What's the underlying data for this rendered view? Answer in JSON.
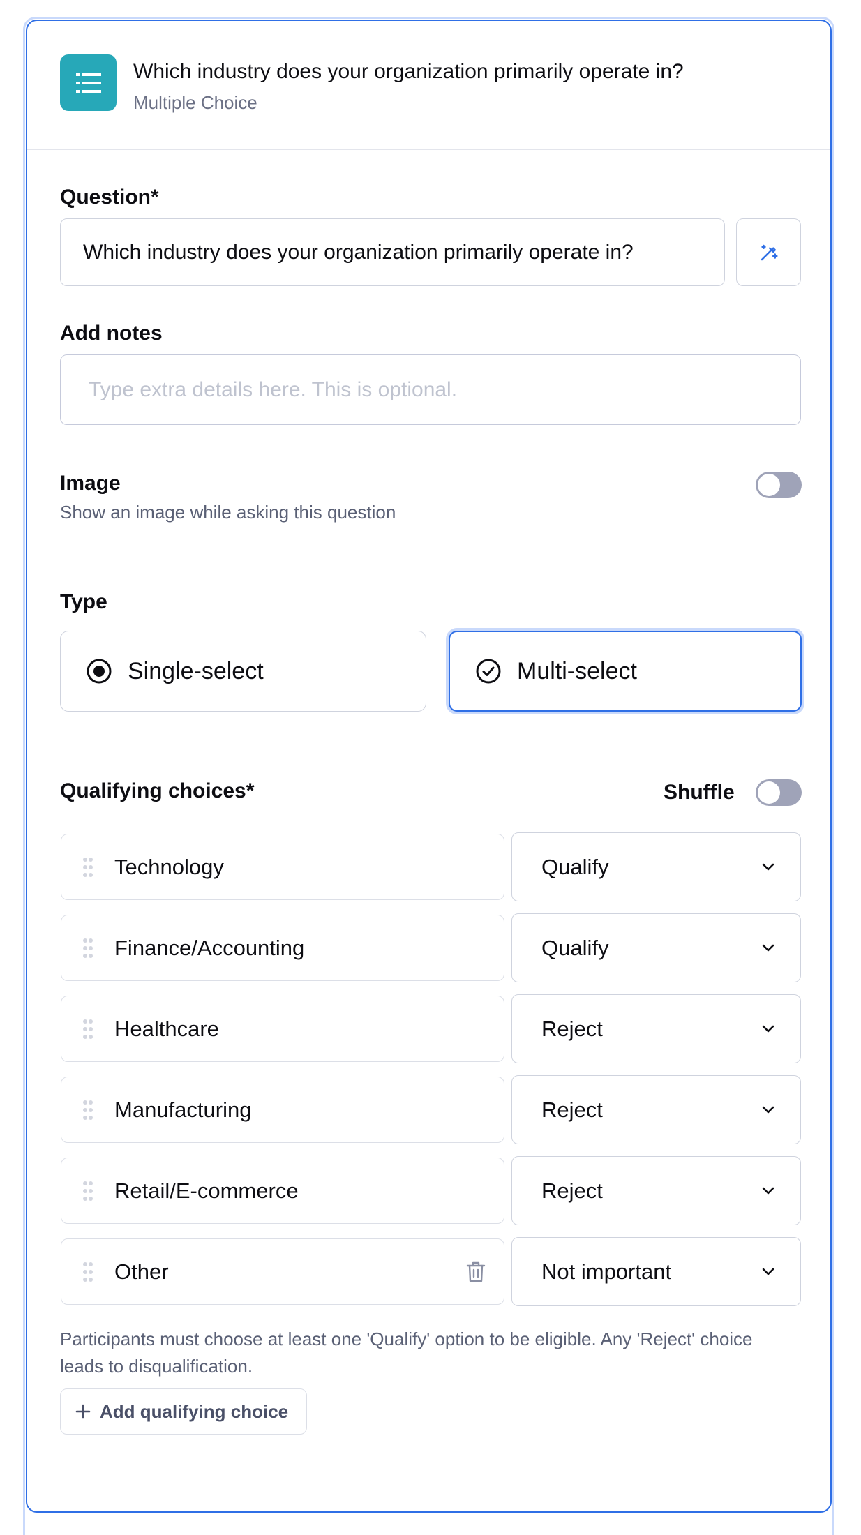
{
  "header": {
    "title": "Which industry does your organization primarily operate in?",
    "subtitle": "Multiple Choice",
    "icon": "list-icon",
    "icon_color": "#27a8b8"
  },
  "question": {
    "label": "Question*",
    "value": "Which industry does your organization primarily operate in?",
    "wand_icon": "magic-wand-icon"
  },
  "notes": {
    "label": "Add notes",
    "placeholder": "Type extra details here. This is optional."
  },
  "image": {
    "label": "Image",
    "description": "Show an image while asking this question",
    "enabled": false
  },
  "type": {
    "label": "Type",
    "options": [
      {
        "label": "Single-select",
        "icon": "radio-icon",
        "selected": false
      },
      {
        "label": "Multi-select",
        "icon": "check-circle-icon",
        "selected": true
      }
    ]
  },
  "choices": {
    "label": "Qualifying choices*",
    "shuffle_label": "Shuffle",
    "shuffle_enabled": false,
    "items": [
      {
        "text": "Technology",
        "status": "Qualify"
      },
      {
        "text": "Finance/Accounting",
        "status": "Qualify"
      },
      {
        "text": "Healthcare",
        "status": "Reject"
      },
      {
        "text": "Manufacturing",
        "status": "Reject"
      },
      {
        "text": "Retail/E-commerce",
        "status": "Reject"
      },
      {
        "text": "Other",
        "status": "Not important"
      }
    ],
    "help": "Participants must choose at least one 'Qualify' option to be eligible. Any 'Reject' choice leads to disqualification.",
    "add_label": "Add qualifying choice"
  },
  "colors": {
    "accent": "#2f6fe6",
    "toggle_off": "#9fa3b8"
  }
}
